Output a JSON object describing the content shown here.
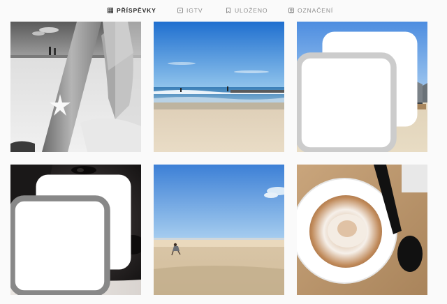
{
  "tabs": [
    {
      "label": "PŘÍSPĚVKY",
      "icon": "grid-icon",
      "active": true
    },
    {
      "label": "IGTV",
      "icon": "igtv-icon",
      "active": false
    },
    {
      "label": "ULOŽENO",
      "icon": "bookmark-icon",
      "active": false
    },
    {
      "label": "OZNAČENÍ",
      "icon": "tagged-icon",
      "active": false
    }
  ],
  "posts": [
    {
      "subject": "black-and-white arm with star tattoo on beach",
      "multiple": false
    },
    {
      "subject": "blue sky beach with sea waves",
      "multiple": false
    },
    {
      "subject": "beach huts on sand dunes",
      "multiple": true
    },
    {
      "subject": "dark dog face on fluffy blanket",
      "multiple": true
    },
    {
      "subject": "child on wide empty beach",
      "multiple": false
    },
    {
      "subject": "cappuccino cup with black spoon",
      "multiple": false
    }
  ],
  "colors": {
    "active_tab": "#262626",
    "inactive_tab": "#8e8e8e",
    "background": "#fafafa"
  }
}
